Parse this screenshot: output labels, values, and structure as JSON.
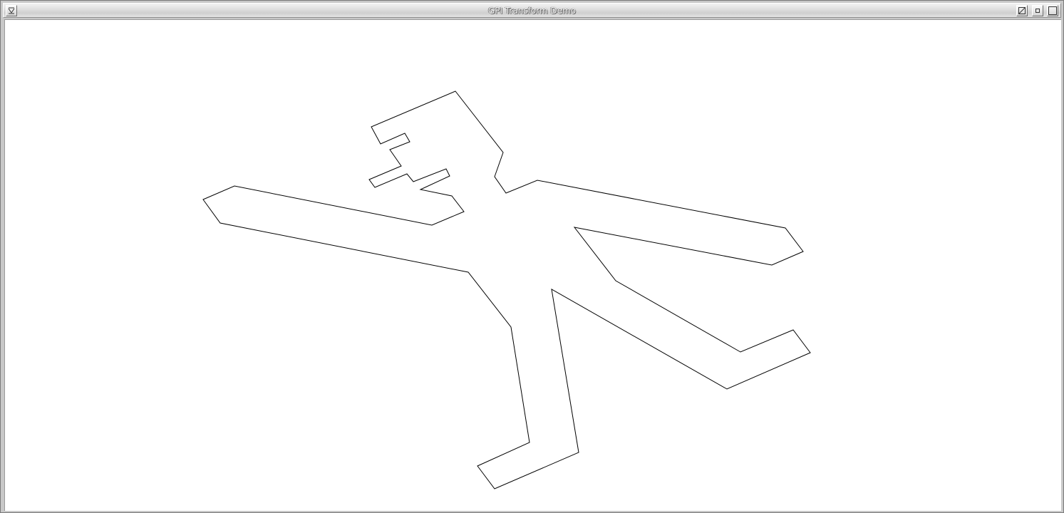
{
  "window": {
    "title": "GPI Transform Demo"
  },
  "titlebar_buttons": [
    {
      "name": "window-menu-button",
      "icon": "window-menu-icon"
    },
    {
      "name": "shade-button",
      "icon": "shade-icon"
    },
    {
      "name": "iconify-button",
      "icon": "iconify-icon"
    },
    {
      "name": "maximize-button",
      "icon": "maximize-icon"
    }
  ],
  "canvas": {
    "background": "#ffffff",
    "stroke": "#000000",
    "shape": "transformed-figure-outline"
  }
}
